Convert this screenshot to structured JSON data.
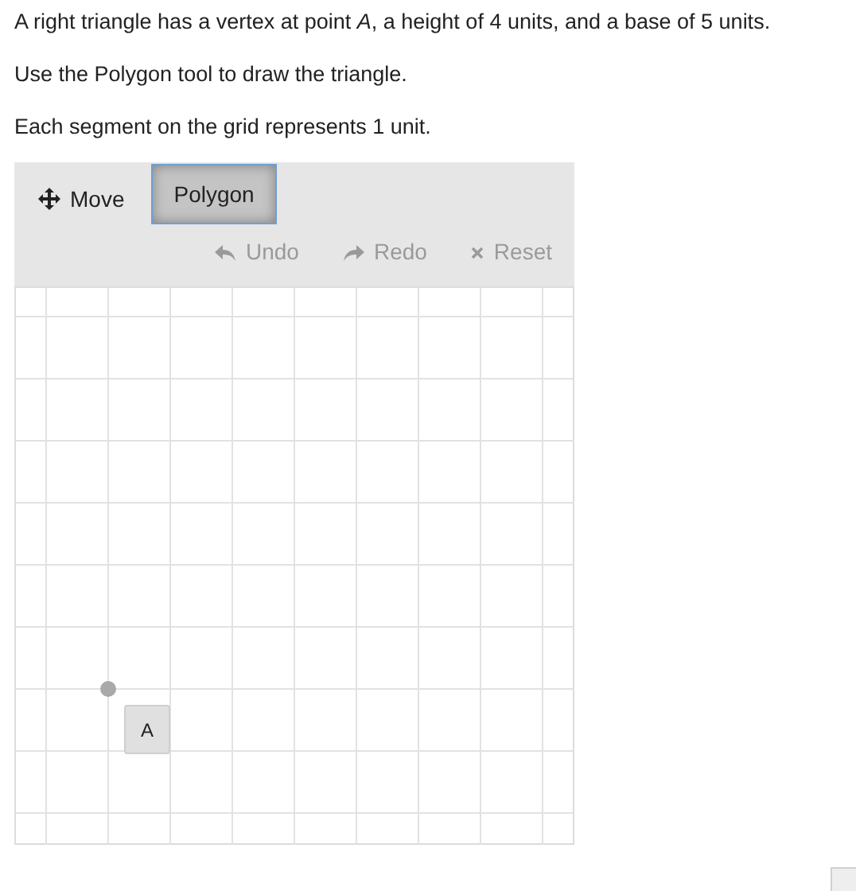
{
  "instructions": [
    "A right triangle has a vertex at point *A*, a height of 4 units, and a base of 5 units.",
    "Use the Polygon tool to draw the triangle.",
    "Each segment on the grid represents 1 unit."
  ],
  "tools": [
    {
      "kind": "move",
      "label": "Move",
      "selected": false
    },
    {
      "kind": "polygon",
      "label": "Polygon",
      "selected": true
    }
  ],
  "actions": [
    {
      "kind": "undo",
      "label": "Undo",
      "disabled": true
    },
    {
      "kind": "redo",
      "label": "Redo",
      "disabled": true
    },
    {
      "kind": "reset",
      "label": "Reset",
      "disabled": true
    }
  ],
  "grid": {
    "points": [
      {
        "label": "A"
      }
    ]
  }
}
